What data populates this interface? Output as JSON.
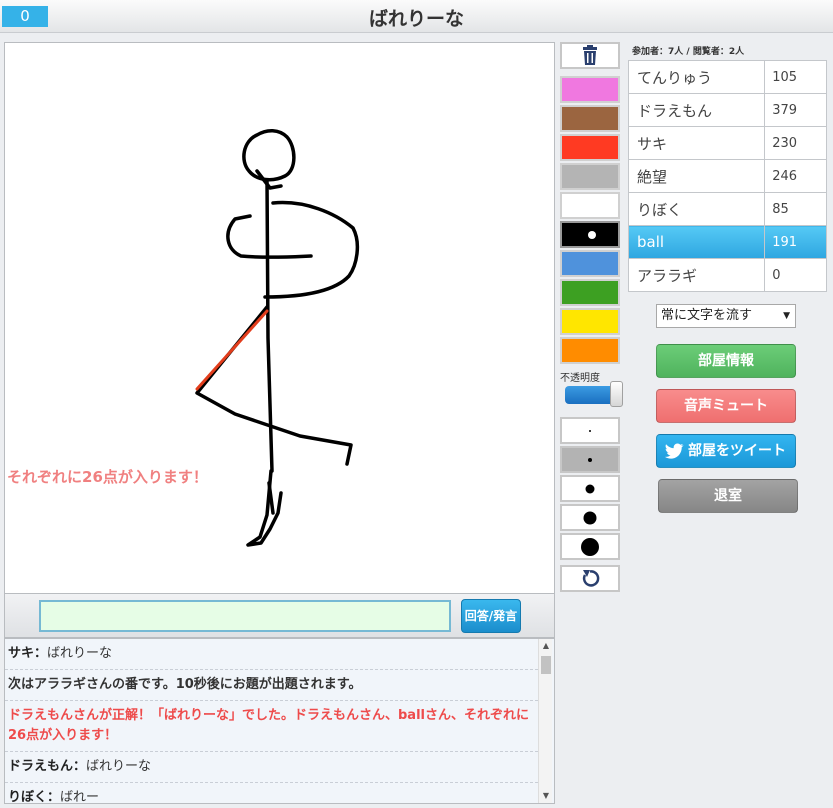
{
  "header": {
    "timer": "0",
    "title": "ばれりーな"
  },
  "canvas": {
    "overlay_message": "それぞれに26点が入ります！"
  },
  "input": {
    "value": "",
    "button_label": "回答/発言"
  },
  "chat": {
    "lines": [
      {
        "name": "サキ：",
        "text": "ばれりーな"
      },
      {
        "text": "次はアララギさんの番です。10秒後にお題が出題されます。"
      },
      {
        "text": "ドラえもんさんが正解！「ばれりーな」でした。ドラえもんさん、ballさん、それぞれに26点が入ります！"
      },
      {
        "name": "ドラえもん：",
        "text": "ばれりーな"
      },
      {
        "name": "りぼく：",
        "text": "ばれー"
      }
    ]
  },
  "tools": {
    "colors": [
      "#f078e0",
      "#9b6540",
      "#ff3a22",
      "#b4b4b4",
      "#ffffff",
      "#000000",
      "#4f92dc",
      "#3da022",
      "#ffe600",
      "#ff8c00"
    ],
    "opacity_label": "不透明度",
    "opacity_value": 1.0,
    "icons": {
      "clear": "trash-icon",
      "undo": "undo-icon"
    }
  },
  "participants": {
    "label": "参加者：7人 / 閲覧者：2人"
  },
  "scores": [
    {
      "name": "てんりゅう",
      "score": "105"
    },
    {
      "name": "ドラえもん",
      "score": "379"
    },
    {
      "name": "サキ",
      "score": "230"
    },
    {
      "name": "絶望",
      "score": "246"
    },
    {
      "name": "りぼく",
      "score": "85"
    },
    {
      "name": "ball",
      "score": "191",
      "active": true
    },
    {
      "name": "アララギ",
      "score": "0"
    }
  ],
  "panel": {
    "mode_select": "常に文字を流す",
    "room_info": "部屋情報",
    "mute": "音声ミュート",
    "tweet": "部屋をツイート",
    "leave": "退室"
  }
}
